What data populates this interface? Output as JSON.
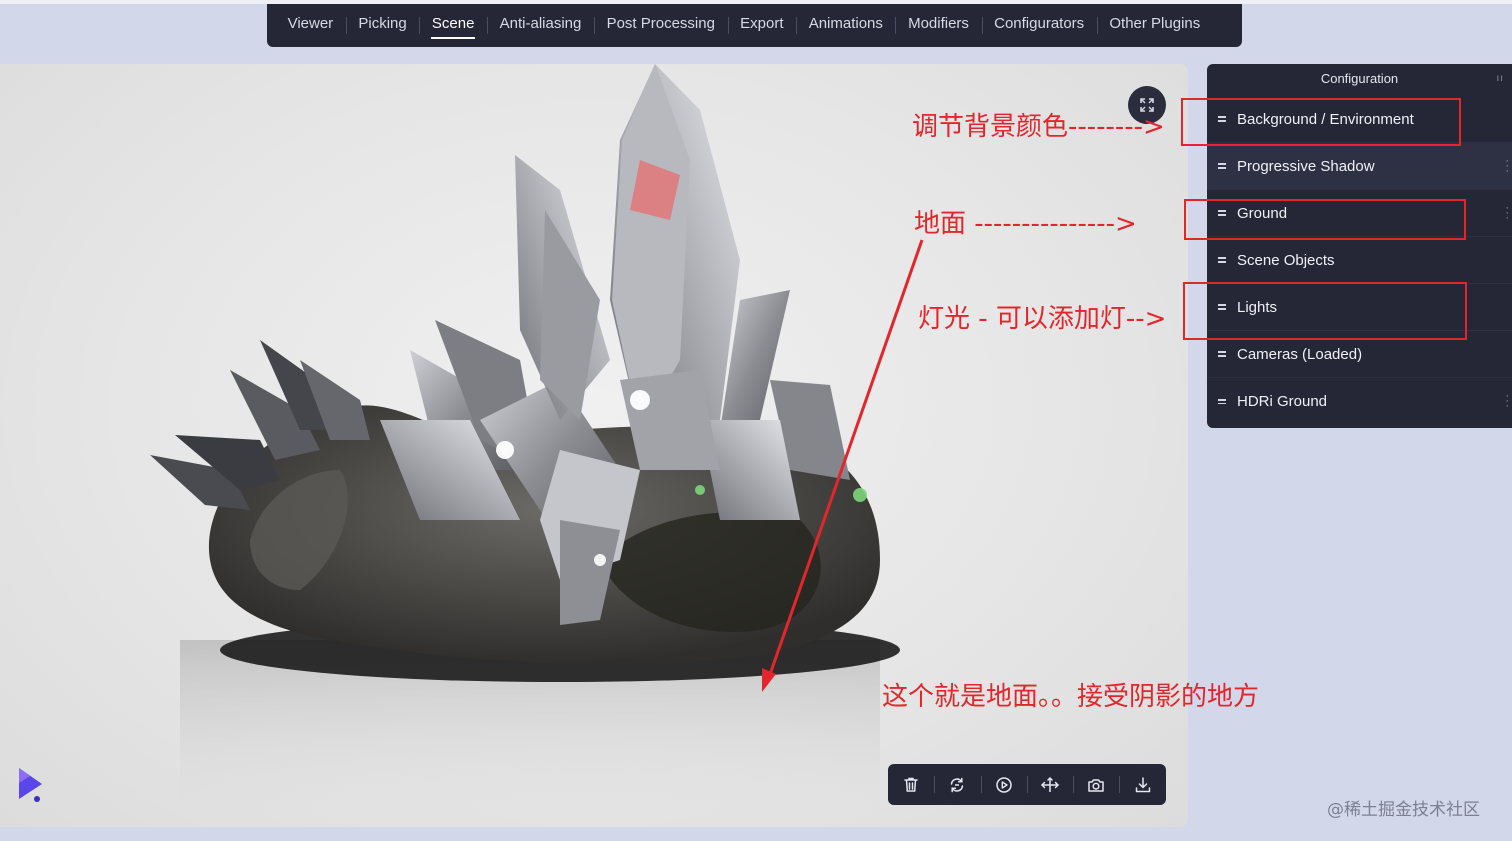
{
  "nav": {
    "tabs": [
      {
        "label": "Viewer"
      },
      {
        "label": "Picking"
      },
      {
        "label": "Scene",
        "active": true
      },
      {
        "label": "Anti-aliasing"
      },
      {
        "label": "Post Processing"
      },
      {
        "label": "Export"
      },
      {
        "label": "Animations"
      },
      {
        "label": "Modifiers"
      },
      {
        "label": "Configurators"
      },
      {
        "label": "Other Plugins"
      }
    ]
  },
  "viewer": {
    "expand_icon": "expand-icon",
    "logo_icon": "play-logo-icon",
    "toolbar": [
      {
        "icon": "trash-icon"
      },
      {
        "icon": "reset-rotate-icon"
      },
      {
        "icon": "play-circle-icon"
      },
      {
        "icon": "move-arrows-icon"
      },
      {
        "icon": "camera-icon"
      },
      {
        "icon": "download-icon"
      }
    ]
  },
  "panel": {
    "title": "Configuration",
    "items": [
      {
        "label": "Background / Environment"
      },
      {
        "label": "Progressive Shadow"
      },
      {
        "label": "Ground"
      },
      {
        "label": "Scene Objects"
      },
      {
        "label": "Lights"
      },
      {
        "label": "Cameras (Loaded)"
      },
      {
        "label": "HDRi Ground"
      }
    ]
  },
  "annotations": {
    "background": "调节背景颜色-------->",
    "ground": "地面 --------------->",
    "lights": "灯光 - 可以添加灯-->",
    "ground_note": "这个就是地面。。接受阴影的地方",
    "color": "#e3262b"
  },
  "watermark": "@稀土掘金技术社区"
}
